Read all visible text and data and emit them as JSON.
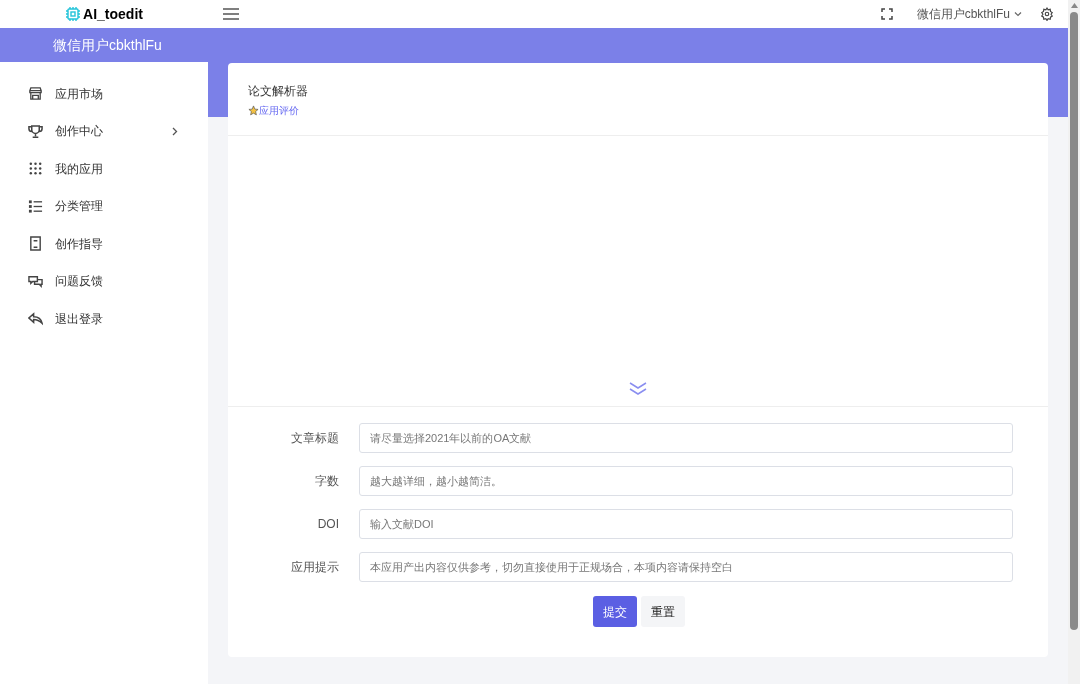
{
  "topbar": {
    "logo": "AI_toedit",
    "user_menu": "微信用户cbkthlFu"
  },
  "sidebar": {
    "header": "微信用户cbkthlFu",
    "items": [
      {
        "kind": "store",
        "label": "应用市场",
        "expandable": false
      },
      {
        "kind": "trophy",
        "label": "创作中心",
        "expandable": true
      },
      {
        "kind": "grid",
        "label": "我的应用",
        "expandable": false
      },
      {
        "kind": "list",
        "label": "分类管理",
        "expandable": false
      },
      {
        "kind": "doc",
        "label": "创作指导",
        "expandable": false
      },
      {
        "kind": "feedback",
        "label": "问题反馈",
        "expandable": false
      },
      {
        "kind": "logout",
        "label": "退出登录",
        "expandable": false
      }
    ]
  },
  "app": {
    "title": "论文解析器",
    "rating_link": "应用评价"
  },
  "form": {
    "fields": [
      {
        "label": "文章标题",
        "placeholder": "请尽量选择2021年以前的OA文献"
      },
      {
        "label": "字数",
        "placeholder": "越大越详细，越小越简洁。"
      },
      {
        "label": "DOI",
        "placeholder": "输入文献DOI"
      },
      {
        "label": "应用提示",
        "placeholder": "本应用产出内容仅供参考，切勿直接使用于正规场合，本项内容请保持空白"
      }
    ],
    "buttons": [
      {
        "kind": "primary",
        "label": "提交"
      },
      {
        "kind": "secondary",
        "label": "重置"
      }
    ]
  }
}
